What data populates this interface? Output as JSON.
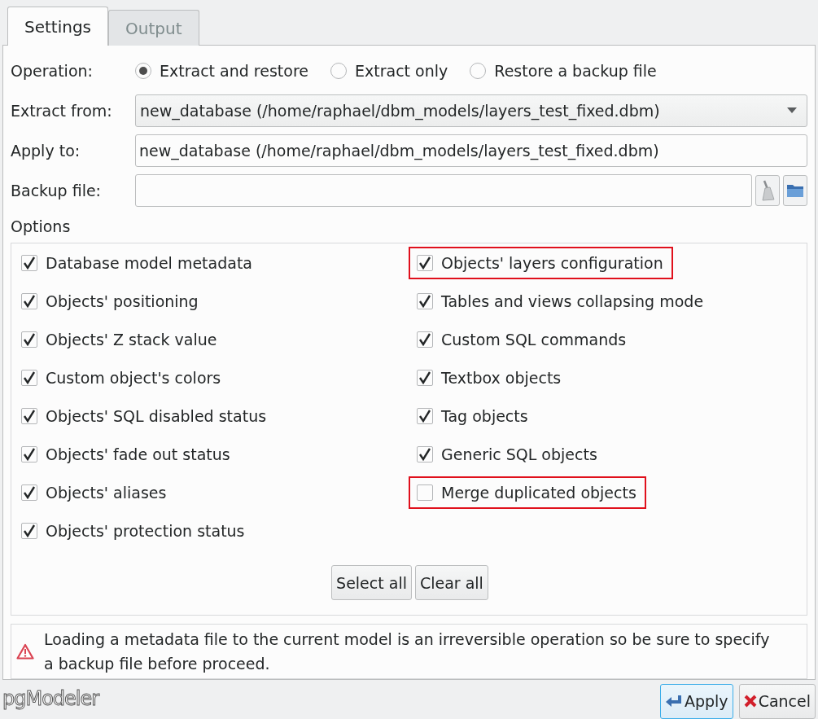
{
  "tabs": [
    {
      "label": "Settings",
      "selected": true
    },
    {
      "label": "Output",
      "selected": false
    }
  ],
  "operation": {
    "label": "Operation:",
    "choices": [
      {
        "label": "Extract and restore",
        "selected": true
      },
      {
        "label": "Extract only",
        "selected": false
      },
      {
        "label": "Restore a backup file",
        "selected": false
      }
    ]
  },
  "extract_from": {
    "label": "Extract from:",
    "value": "new_database (/home/raphael/dbm_models/layers_test_fixed.dbm)"
  },
  "apply_to": {
    "label": "Apply to:",
    "value": "new_database (/home/raphael/dbm_models/layers_test_fixed.dbm)"
  },
  "backup_file": {
    "label": "Backup file:"
  },
  "options": {
    "title": "Options",
    "column_1": [
      {
        "label": "Database model metadata",
        "checked": true,
        "highlighted": false
      },
      {
        "label": "Objects' positioning",
        "checked": true,
        "highlighted": false
      },
      {
        "label": "Objects' Z stack value",
        "checked": true,
        "highlighted": false
      },
      {
        "label": "Custom object's colors",
        "checked": true,
        "highlighted": false
      },
      {
        "label": "Objects' SQL disabled status",
        "checked": true,
        "highlighted": false
      },
      {
        "label": "Objects' fade out status",
        "checked": true,
        "highlighted": false
      },
      {
        "label": "Objects' aliases",
        "checked": true,
        "highlighted": false
      },
      {
        "label": "Objects' protection status",
        "checked": true,
        "highlighted": false
      }
    ],
    "column_2": [
      {
        "label": "Objects' layers configuration",
        "checked": true,
        "highlighted": true
      },
      {
        "label": "Tables and views collapsing mode",
        "checked": true,
        "highlighted": false
      },
      {
        "label": "Custom SQL commands",
        "checked": true,
        "highlighted": false
      },
      {
        "label": "Textbox objects",
        "checked": true,
        "highlighted": false
      },
      {
        "label": "Tag objects",
        "checked": true,
        "highlighted": false
      },
      {
        "label": "Generic SQL objects",
        "checked": true,
        "highlighted": false
      },
      {
        "label": "Merge duplicated objects",
        "checked": false,
        "highlighted": true
      }
    ],
    "buttons": [
      "Select all",
      "Clear all"
    ]
  },
  "warning": "Loading a metadata file to the current model is an irreversible operation so be sure to specify a backup file before proceed.",
  "logo": "pgModeler",
  "dialog_buttons": [
    {
      "kind": "apply",
      "label": "Apply"
    },
    {
      "kind": "cancel",
      "label": "Cancel"
    }
  ]
}
